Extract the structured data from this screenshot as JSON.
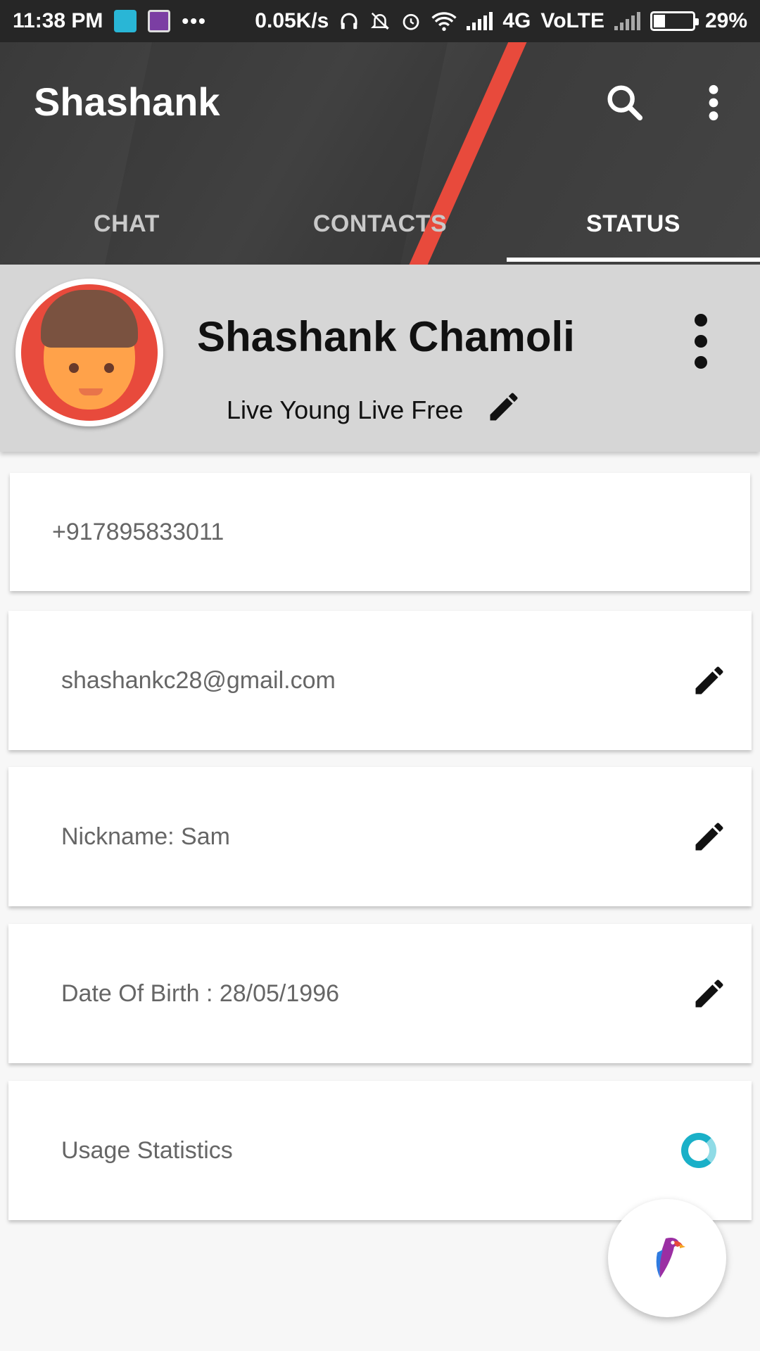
{
  "status_bar": {
    "time": "11:38 PM",
    "more": "•••",
    "speed": "0.05K/s",
    "network": "4G",
    "volte": "VoLTE",
    "battery": "29%",
    "battery_level": 0.29
  },
  "app_bar": {
    "title": "Shashank",
    "search_icon": "search-icon",
    "overflow_icon": "more-vert-icon",
    "accent": "#e84a3c"
  },
  "tabs": [
    {
      "label": "CHAT",
      "active": false
    },
    {
      "label": "CONTACTS",
      "active": false
    },
    {
      "label": "STATUS",
      "active": true
    }
  ],
  "profile": {
    "name": "Shashank Chamoli",
    "status": "Live Young Live Free",
    "avatar_bg": "#e84a3c"
  },
  "info": {
    "phone": "+917895833011",
    "email": "shashankc28@gmail.com",
    "nickname": "Nickname: Sam",
    "dob": "Date Of Birth : 28/05/1996",
    "usage": "Usage Statistics"
  },
  "fab": {
    "icon": "parrot-icon"
  }
}
